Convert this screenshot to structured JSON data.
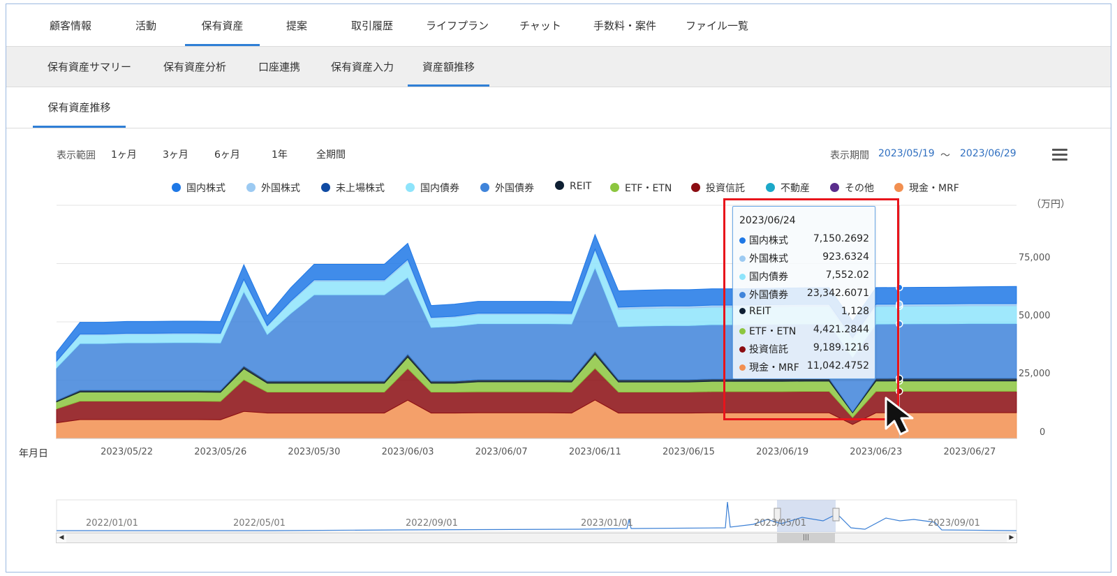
{
  "main_tabs": [
    "顧客情報",
    "活動",
    "保有資産",
    "提案",
    "取引履歴",
    "ライフプラン",
    "チャット",
    "手数料・案件",
    "ファイル一覧"
  ],
  "sub_tabs": [
    "保有資産サマリー",
    "保有資産分析",
    "口座連携",
    "保有資産入力",
    "資産額推移"
  ],
  "third_tab": "保有資産推移",
  "controls": {
    "range_label": "表示範囲",
    "range_options": [
      "1ヶ月",
      "3ヶ月",
      "6ヶ月",
      "1年",
      "全期間"
    ],
    "period_label": "表示期間",
    "period_start": "2023/05/19",
    "period_separator": "～",
    "period_end": "2023/06/29"
  },
  "legend": [
    {
      "name": "国内株式",
      "color": "#1e78e6"
    },
    {
      "name": "外国株式",
      "color": "#9ccaf2"
    },
    {
      "name": "未上場株式",
      "color": "#0f4aa3"
    },
    {
      "name": "国内債券",
      "color": "#8ee4fb"
    },
    {
      "name": "外国債券",
      "color": "#3f84da"
    },
    {
      "name": "REIT",
      "color": "#0e1f33"
    },
    {
      "name": "ETF・ETN",
      "color": "#8cc63f"
    },
    {
      "name": "投資信託",
      "color": "#8b0d12"
    },
    {
      "name": "不動産",
      "color": "#1ca8c8"
    },
    {
      "name": "その他",
      "color": "#5a2d8c"
    },
    {
      "name": "現金・MRF",
      "color": "#f28f50"
    }
  ],
  "tooltip": {
    "date": "2023/06/24",
    "rows": [
      {
        "name": "国内株式",
        "value": "7,150.2692",
        "color": "#1e78e6"
      },
      {
        "name": "外国株式",
        "value": "923.6324",
        "color": "#9ccaf2"
      },
      {
        "name": "国内債券",
        "value": "7,552.02",
        "color": "#8ee4fb"
      },
      {
        "name": "外国債券",
        "value": "23,342.6071",
        "color": "#3f84da"
      },
      {
        "name": "REIT",
        "value": "1,128",
        "color": "#0e1f33"
      },
      {
        "name": "ETF・ETN",
        "value": "4,421.2844",
        "color": "#8cc63f"
      },
      {
        "name": "投資信託",
        "value": "9,189.1216",
        "color": "#8b0d12"
      },
      {
        "name": "現金・MRF",
        "value": "11,042.4752",
        "color": "#f28f50"
      }
    ]
  },
  "chart_data": {
    "type": "area",
    "stacked": true,
    "x_start": "2023/05/19",
    "x_end": "2023/06/29",
    "x_tick_labels": [
      "2023/05/22",
      "2023/05/26",
      "2023/05/30",
      "2023/06/03",
      "2023/06/07",
      "2023/06/11",
      "2023/06/15",
      "2023/06/19",
      "2023/06/23",
      "2023/06/27"
    ],
    "xlabel": "年月日",
    "ylabel": "（万円）",
    "y_tick_labels": [
      "0",
      "25,000",
      "50,000",
      "75,000"
    ],
    "ylim": [
      0,
      100000
    ],
    "grid": true,
    "dates": [
      "2023/05/19",
      "2023/05/20",
      "2023/05/21",
      "2023/05/22",
      "2023/05/23",
      "2023/05/24",
      "2023/05/25",
      "2023/05/26",
      "2023/05/27",
      "2023/05/28",
      "2023/05/29",
      "2023/05/30",
      "2023/05/31",
      "2023/06/01",
      "2023/06/02",
      "2023/06/03",
      "2023/06/04",
      "2023/06/05",
      "2023/06/06",
      "2023/06/07",
      "2023/06/08",
      "2023/06/09",
      "2023/06/10",
      "2023/06/11",
      "2023/06/12",
      "2023/06/13",
      "2023/06/14",
      "2023/06/15",
      "2023/06/16",
      "2023/06/17",
      "2023/06/18",
      "2023/06/19",
      "2023/06/20",
      "2023/06/21",
      "2023/06/22",
      "2023/06/23",
      "2023/06/24",
      "2023/06/25",
      "2023/06/26",
      "2023/06/27",
      "2023/06/28",
      "2023/06/29"
    ],
    "series": [
      {
        "name": "現金・MRF",
        "color": "#f28f50",
        "values": [
          6700,
          8100,
          8100,
          8100,
          8100,
          8100,
          8100,
          8000,
          11600,
          10900,
          10900,
          10900,
          10900,
          10900,
          10900,
          16400,
          10900,
          10900,
          11000,
          11000,
          11000,
          11000,
          10900,
          16500,
          10900,
          10900,
          10900,
          10900,
          11000,
          11000,
          11000,
          11000,
          11000,
          11000,
          6000,
          11000,
          11042,
          11042,
          11042,
          11042,
          11042,
          11042
        ]
      },
      {
        "name": "投資信託",
        "color": "#8b0d12",
        "values": [
          6000,
          7900,
          7900,
          7900,
          7900,
          7900,
          7900,
          7900,
          13600,
          9000,
          9000,
          9000,
          9000,
          9000,
          9000,
          13600,
          9000,
          9000,
          9000,
          9000,
          9000,
          9000,
          9000,
          13600,
          9000,
          9000,
          9000,
          9000,
          9100,
          9100,
          9100,
          9100,
          9200,
          9200,
          3000,
          9189,
          9189,
          9189,
          9189,
          9189,
          9189,
          9189
        ]
      },
      {
        "name": "ETF・ETN",
        "color": "#8cc63f",
        "values": [
          3000,
          3900,
          3900,
          3900,
          3900,
          3900,
          3900,
          3900,
          4700,
          3800,
          3800,
          3800,
          3800,
          3800,
          3800,
          4900,
          3800,
          3800,
          4300,
          4300,
          4300,
          4300,
          4300,
          6000,
          4300,
          4300,
          4300,
          4300,
          4400,
          4400,
          4400,
          4400,
          4400,
          4400,
          2000,
          4421,
          4421,
          4421,
          4421,
          4421,
          4421,
          4421
        ]
      },
      {
        "name": "REIT",
        "color": "#0e1f33",
        "values": [
          600,
          800,
          800,
          800,
          800,
          800,
          800,
          800,
          1100,
          900,
          900,
          900,
          900,
          900,
          900,
          1200,
          900,
          900,
          900,
          900,
          900,
          900,
          900,
          1200,
          1000,
          1000,
          1000,
          1000,
          1000,
          1000,
          1100,
          1100,
          1100,
          1100,
          400,
          1128,
          1128,
          1128,
          1128,
          1128,
          1128,
          1128
        ]
      },
      {
        "name": "外国債券",
        "color": "#3f84da",
        "values": [
          14000,
          20000,
          20000,
          20300,
          20300,
          20400,
          20400,
          20400,
          32000,
          20000,
          29000,
          37000,
          37000,
          37000,
          37000,
          33000,
          23000,
          23500,
          24000,
          24000,
          24000,
          24000,
          24000,
          36000,
          22700,
          23000,
          23200,
          23200,
          23300,
          23300,
          23300,
          23400,
          23400,
          23400,
          23400,
          23343,
          23343,
          23400,
          23400,
          23500,
          23500,
          23500
        ]
      },
      {
        "name": "国内債券",
        "color": "#8ee4fb",
        "values": [
          2600,
          3700,
          3700,
          3700,
          3700,
          3700,
          3700,
          3700,
          4800,
          3400,
          4800,
          5800,
          5800,
          5800,
          5800,
          7000,
          3900,
          3900,
          4000,
          4000,
          4000,
          4000,
          4000,
          7200,
          7500,
          7500,
          7500,
          7500,
          7500,
          7500,
          7500,
          7500,
          7500,
          7500,
          7500,
          7552,
          7552,
          7552,
          7600,
          7600,
          7600,
          7600
        ]
      },
      {
        "name": "外国株式",
        "color": "#9ccaf2",
        "values": [
          300,
          400,
          400,
          400,
          400,
          400,
          400,
          400,
          500,
          400,
          500,
          600,
          600,
          600,
          600,
          700,
          400,
          400,
          500,
          500,
          500,
          500,
          500,
          700,
          900,
          900,
          900,
          900,
          900,
          900,
          900,
          900,
          900,
          900,
          900,
          924,
          924,
          924,
          924,
          924,
          924,
          924
        ]
      },
      {
        "name": "国内株式",
        "color": "#1e78e6",
        "values": [
          3800,
          5000,
          5000,
          5100,
          5100,
          5100,
          5100,
          5100,
          6200,
          4200,
          5700,
          6700,
          6700,
          6700,
          6700,
          6900,
          5100,
          5200,
          5100,
          5100,
          5100,
          5100,
          5100,
          6200,
          7000,
          7000,
          7000,
          7000,
          7000,
          7000,
          7000,
          7100,
          7100,
          7100,
          7100,
          7150,
          7150,
          7150,
          7150,
          7200,
          7300,
          7400
        ]
      }
    ],
    "navigator": {
      "labels": [
        "2022/01/01",
        "2022/05/01",
        "2022/09/01",
        "2023/01/01",
        "2023/05/01",
        "2023/09/01"
      ]
    }
  }
}
